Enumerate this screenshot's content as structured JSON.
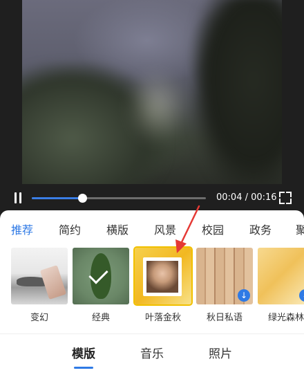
{
  "player": {
    "current_time": "00:04",
    "duration": "00:16",
    "time_text": "00:04 / 00:16",
    "progress_fraction": 0.29
  },
  "categories": [
    {
      "label": "推荐",
      "active": true
    },
    {
      "label": "简约",
      "active": false
    },
    {
      "label": "横版",
      "active": false
    },
    {
      "label": "风景",
      "active": false
    },
    {
      "label": "校园",
      "active": false
    },
    {
      "label": "政务",
      "active": false
    },
    {
      "label": "聚",
      "active": false
    }
  ],
  "templates": [
    {
      "label": "变幻",
      "selected": false,
      "downloadable": false
    },
    {
      "label": "经典",
      "selected": false,
      "downloadable": false,
      "applied": true
    },
    {
      "label": "叶落金秋",
      "selected": true,
      "downloadable": false
    },
    {
      "label": "秋日私语",
      "selected": false,
      "downloadable": true
    },
    {
      "label": "绿光森林",
      "selected": false,
      "downloadable": true
    }
  ],
  "bottom_tabs": [
    {
      "label": "模版",
      "active": true
    },
    {
      "label": "音乐",
      "active": false
    },
    {
      "label": "照片",
      "active": false
    }
  ],
  "colors": {
    "accent": "#2f7ae5",
    "annotation": "#e53935",
    "selected_border": "#f1c000"
  },
  "icons": {
    "pause": "pause-icon",
    "fullscreen": "fullscreen-icon",
    "download": "download-icon",
    "applied": "check-icon"
  }
}
